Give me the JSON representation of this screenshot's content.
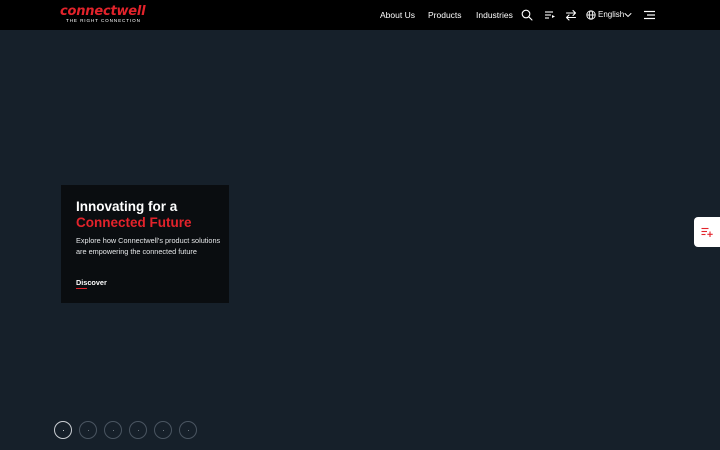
{
  "header": {
    "logo": {
      "name": "connectwell",
      "tagline": "THE RIGHT CONNECTION"
    },
    "nav": [
      {
        "label": "About Us"
      },
      {
        "label": "Products"
      },
      {
        "label": "Industries"
      }
    ],
    "icons": [
      "search-icon",
      "product-list-icon",
      "compare-icon",
      "globe-icon",
      "menu-icon"
    ],
    "language": {
      "label": "English"
    }
  },
  "hero": {
    "title_line1": "Innovating for a",
    "title_line2": "Connected Future",
    "description": "Explore how Connectwell's product solutions are empowering the connected future",
    "cta_label": "Discover"
  },
  "side_widget": {
    "icon": "list-add-icon"
  },
  "carousel": {
    "slide_count": 6,
    "active_index": 0
  },
  "colors": {
    "brand_red": "#e3232b",
    "background": "#16202a",
    "header_bg": "#000000",
    "card_bg": "#0a0d10"
  }
}
